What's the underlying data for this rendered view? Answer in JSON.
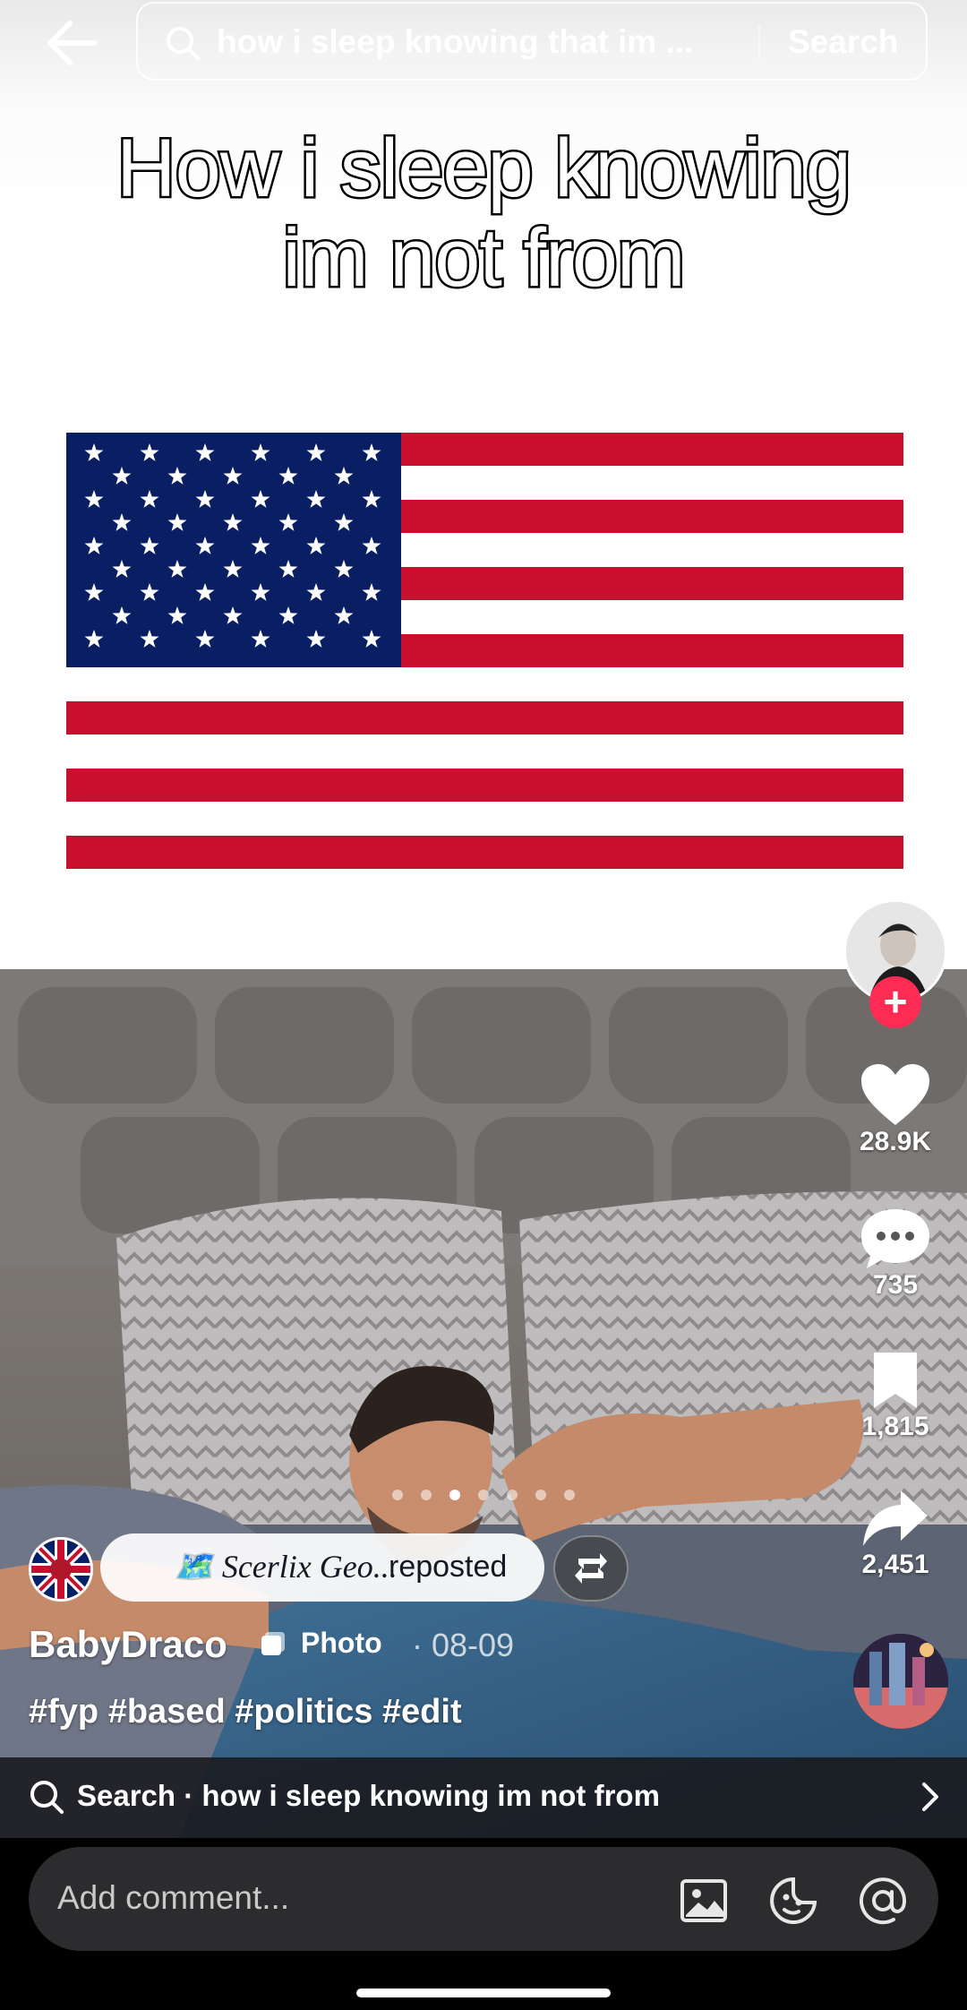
{
  "search": {
    "query": "how i sleep knowing that im ...",
    "button_label": "Search"
  },
  "meme": {
    "caption_line1": "How i sleep knowing",
    "caption_line2": "im not from"
  },
  "actions": {
    "likes": "28.9K",
    "comments": "735",
    "saves": "1,815",
    "shares": "2,451"
  },
  "carousel": {
    "total": 7,
    "active": 2
  },
  "repost": {
    "reposter_name": "🗺️ Scerlix Geo...",
    "label": "reposted"
  },
  "post": {
    "author": "BabyDraco",
    "type_label": "Photo",
    "date": "· 08-09",
    "hashtags": "#fyp #based #politics #edit"
  },
  "suggestion": {
    "text": "Search · how i sleep knowing im not from"
  },
  "comment": {
    "placeholder": "Add comment..."
  },
  "colors": {
    "follow_accent": "#fe2c55",
    "flag_red": "#c8102e",
    "flag_blue": "#0a1f63"
  }
}
